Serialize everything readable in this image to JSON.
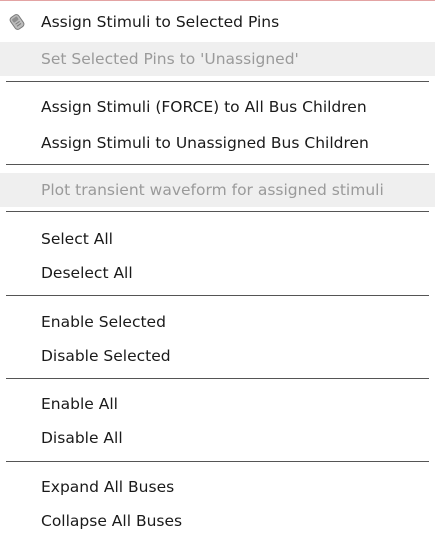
{
  "menu": {
    "items": [
      {
        "label": "Assign Stimuli to Selected Pins",
        "icon": "stimuli-pin-icon",
        "enabled": true
      },
      {
        "label": "Set Selected Pins to 'Unassigned'",
        "enabled": false
      },
      {
        "label": "Assign Stimuli (FORCE) to All Bus Children",
        "enabled": true
      },
      {
        "label": "Assign Stimuli to Unassigned Bus Children",
        "enabled": true
      },
      {
        "label": "Plot transient waveform for assigned stimuli",
        "enabled": false
      },
      {
        "label": "Select All",
        "enabled": true
      },
      {
        "label": "Deselect All",
        "enabled": true
      },
      {
        "label": "Enable Selected",
        "enabled": true
      },
      {
        "label": "Disable Selected",
        "enabled": true
      },
      {
        "label": "Enable All",
        "enabled": true
      },
      {
        "label": "Disable All",
        "enabled": true
      },
      {
        "label": "Expand All Buses",
        "enabled": true
      },
      {
        "label": "Collapse All Buses",
        "enabled": true
      }
    ]
  },
  "colors": {
    "disabled_text": "#9a9a9a",
    "disabled_background": "#efefef",
    "separator": "#555555"
  }
}
